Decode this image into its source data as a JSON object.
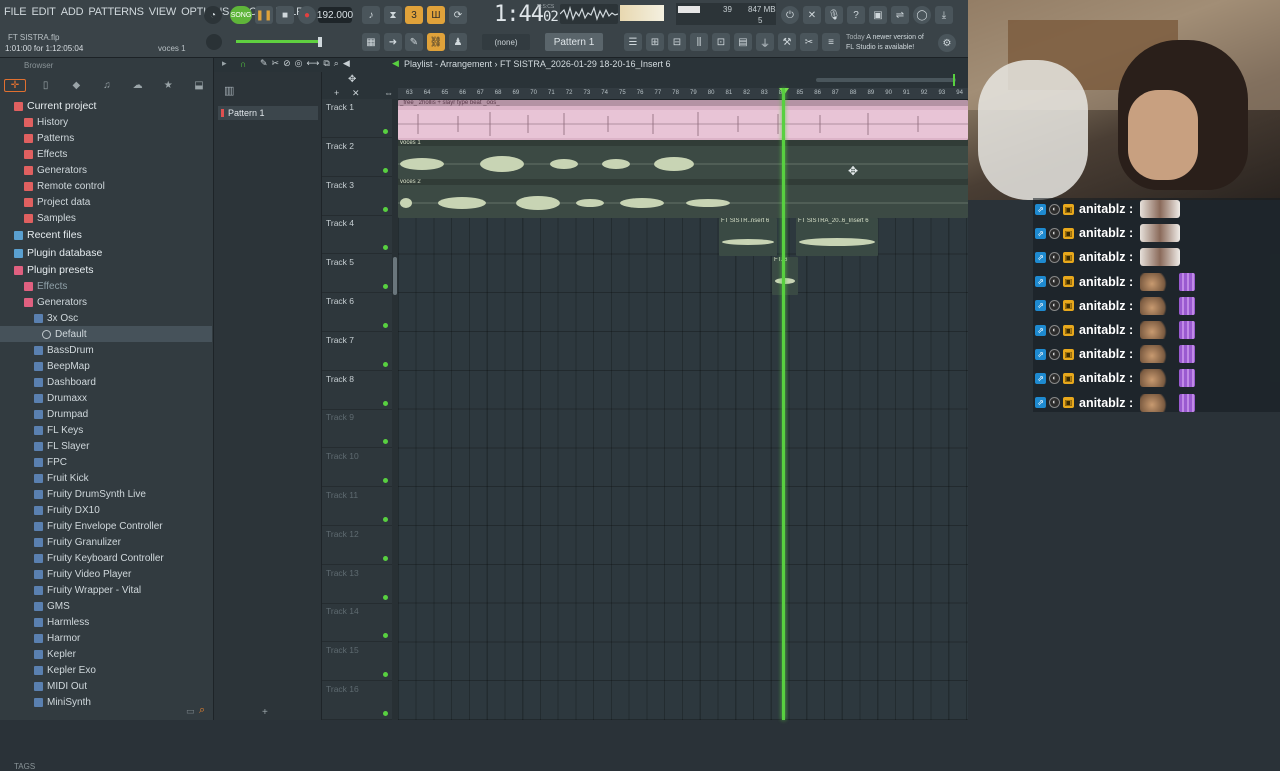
{
  "menu": [
    "FILE",
    "EDIT",
    "ADD",
    "PATTERNS",
    "VIEW",
    "OPTIONS",
    "TOOLS",
    "HELP"
  ],
  "project": {
    "file": "FT SISTRA.flp",
    "position": "1:01:00 for 1:12:05:04",
    "voice": "voces 1"
  },
  "transport": {
    "song_label": "SONG",
    "tempo": "192.000",
    "time_main": "1:44",
    "time_sub": "02",
    "time_unit": "M:S:CS"
  },
  "monitor": {
    "cpu": "39",
    "memory": "847 MB",
    "polyphony": "5"
  },
  "toolbar": {
    "pattern_none": "(none)",
    "pattern_selected": "Pattern 1"
  },
  "news": {
    "label": "Today",
    "text1": "A newer version of",
    "text2": "FL Studio is available!"
  },
  "browser": {
    "title": "Browser",
    "tags_label": "TAGS",
    "items": [
      {
        "label": "Current project",
        "level": 0,
        "color": "#e06060",
        "hdr": true
      },
      {
        "label": "History",
        "level": 1,
        "color": "#e06060"
      },
      {
        "label": "Patterns",
        "level": 1,
        "color": "#e06060"
      },
      {
        "label": "Effects",
        "level": 1,
        "color": "#e06060"
      },
      {
        "label": "Generators",
        "level": 1,
        "color": "#e06060"
      },
      {
        "label": "Remote control",
        "level": 1,
        "color": "#e06060"
      },
      {
        "label": "Project data",
        "level": 1,
        "color": "#e06060"
      },
      {
        "label": "Samples",
        "level": 1,
        "color": "#e06060"
      },
      {
        "label": "Recent files",
        "level": 0,
        "color": "#5aa0d0",
        "hdr": true
      },
      {
        "label": "Plugin database",
        "level": 0,
        "color": "#5aa0d0",
        "hdr": true
      },
      {
        "label": "Plugin presets",
        "level": 0,
        "color": "#e06080",
        "hdr": true
      },
      {
        "label": "Effects",
        "level": 1,
        "color": "#e06080",
        "muted": true
      },
      {
        "label": "Generators",
        "level": 1,
        "color": "#e06080"
      },
      {
        "label": "3x Osc",
        "level": 2,
        "color": "#5a80b0"
      },
      {
        "label": "Default",
        "level": 3,
        "color": "#c0c8cc",
        "selected": true
      },
      {
        "label": "BassDrum",
        "level": 2,
        "color": "#5a80b0"
      },
      {
        "label": "BeepMap",
        "level": 2,
        "color": "#5a80b0"
      },
      {
        "label": "Dashboard",
        "level": 2,
        "color": "#5a80b0"
      },
      {
        "label": "Drumaxx",
        "level": 2,
        "color": "#5a80b0"
      },
      {
        "label": "Drumpad",
        "level": 2,
        "color": "#5a80b0"
      },
      {
        "label": "FL Keys",
        "level": 2,
        "color": "#5a80b0"
      },
      {
        "label": "FL Slayer",
        "level": 2,
        "color": "#5a80b0"
      },
      {
        "label": "FPC",
        "level": 2,
        "color": "#5a80b0"
      },
      {
        "label": "Fruit Kick",
        "level": 2,
        "color": "#5a80b0"
      },
      {
        "label": "Fruity DrumSynth Live",
        "level": 2,
        "color": "#5a80b0"
      },
      {
        "label": "Fruity DX10",
        "level": 2,
        "color": "#5a80b0"
      },
      {
        "label": "Fruity Envelope Controller",
        "level": 2,
        "color": "#5a80b0"
      },
      {
        "label": "Fruity Granulizer",
        "level": 2,
        "color": "#5a80b0"
      },
      {
        "label": "Fruity Keyboard Controller",
        "level": 2,
        "color": "#5a80b0"
      },
      {
        "label": "Fruity Video Player",
        "level": 2,
        "color": "#5a80b0"
      },
      {
        "label": "Fruity Wrapper - Vital",
        "level": 2,
        "color": "#5a80b0"
      },
      {
        "label": "GMS",
        "level": 2,
        "color": "#5a80b0"
      },
      {
        "label": "Harmless",
        "level": 2,
        "color": "#5a80b0"
      },
      {
        "label": "Harmor",
        "level": 2,
        "color": "#5a80b0"
      },
      {
        "label": "Kepler",
        "level": 2,
        "color": "#5a80b0"
      },
      {
        "label": "Kepler Exo",
        "level": 2,
        "color": "#5a80b0"
      },
      {
        "label": "MIDI Out",
        "level": 2,
        "color": "#5a80b0"
      },
      {
        "label": "MiniSynth",
        "level": 2,
        "color": "#5a80b0"
      }
    ]
  },
  "pattern_strip": {
    "item": "Pattern 1"
  },
  "playlist": {
    "title": "Playlist - Arrangement",
    "breadcrumb": "FT SISTRA_2026-01-29 18-20-16_Insert 6",
    "tracks": [
      "Track 1",
      "Track 2",
      "Track 3",
      "Track 4",
      "Track 5",
      "Track 6",
      "Track 7",
      "Track 8",
      "Track 9",
      "Track 10",
      "Track 11",
      "Track 12",
      "Track 13",
      "Track 14",
      "Track 15",
      "Track 16"
    ],
    "ruler": [
      "63",
      "64",
      "65",
      "66",
      "67",
      "68",
      "69",
      "70",
      "71",
      "72",
      "73",
      "74",
      "75",
      "76",
      "77",
      "78",
      "79",
      "80",
      "81",
      "82",
      "83",
      "84",
      "85",
      "86",
      "87",
      "88",
      "89",
      "90",
      "91",
      "92",
      "93",
      "94"
    ],
    "clips": {
      "c1": "_free_ 2hollis + slayr type beat _oos_",
      "c2": "voces 1",
      "c3": "voces 2",
      "c4": "FT SISTR..nsert 6",
      "c5": "FT SISTRA_20..6_Insert 6",
      "c6": "FT..6"
    }
  },
  "chat": {
    "messages": [
      {
        "user": "anitablz :",
        "emote": "a"
      },
      {
        "user": "anitablz :",
        "emote": "a"
      },
      {
        "user": "anitablz :",
        "emote": "a"
      },
      {
        "user": "anitablz :",
        "emote": "b"
      },
      {
        "user": "anitablz :",
        "emote": "b"
      },
      {
        "user": "anitablz :",
        "emote": "b"
      },
      {
        "user": "anitablz :",
        "emote": "b"
      },
      {
        "user": "anitablz :",
        "emote": "b"
      },
      {
        "user": "anitablz :",
        "emote": "b"
      }
    ]
  }
}
